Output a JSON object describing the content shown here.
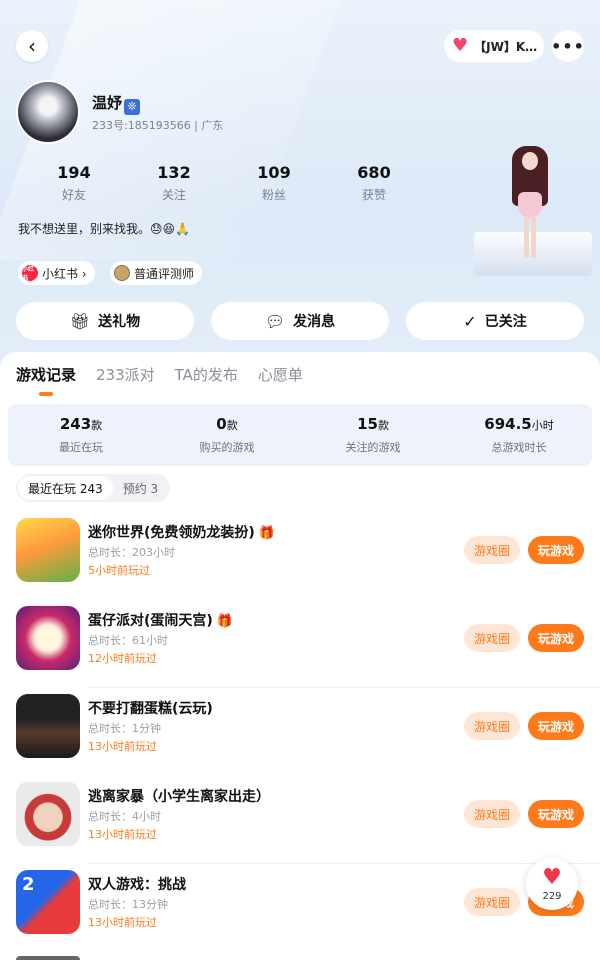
{
  "header": {
    "back_glyph": "‹",
    "pill_label": "【JW】K…",
    "more_glyph": "•••"
  },
  "profile": {
    "nickname": "温妤",
    "nick_badge": "❊",
    "uid_line": "233号:185193566 | 广东",
    "stats": [
      {
        "value": "194",
        "label": "好友"
      },
      {
        "value": "132",
        "label": "关注"
      },
      {
        "value": "109",
        "label": "粉丝"
      },
      {
        "value": "680",
        "label": "获赞"
      }
    ],
    "bio": "我不想送里，别来找我。😓😆🙏",
    "tags": {
      "xhs_icon": "小红书",
      "xhs": "小红书 ›",
      "judge": "普通评测师"
    },
    "actions": {
      "gift": "送礼物",
      "message": "发消息",
      "follow": "已关注"
    }
  },
  "tabs": [
    "游戏记录",
    "233派对",
    "TA的发布",
    "心愿单"
  ],
  "summary": [
    {
      "value": "243",
      "unit": "款",
      "label": "最近在玩"
    },
    {
      "value": "0",
      "unit": "款",
      "label": "购买的游戏"
    },
    {
      "value": "15",
      "unit": "款",
      "label": "关注的游戏"
    },
    {
      "value": "694.5",
      "unit": "小时",
      "label": "总游戏时长"
    }
  ],
  "segments": {
    "recent": "最近在玩 243",
    "reserve": "预约 3"
  },
  "games": [
    {
      "title": "迷你世界(免费领奶龙装扮)",
      "crown": "🎁",
      "duration": "总时长：203小时",
      "last": "5小时前玩过",
      "circle": "游戏圈",
      "play": "玩游戏"
    },
    {
      "title": "蛋仔派对(蛋闹天宫)",
      "crown": "🎁",
      "duration": "总时长：61小时",
      "last": "12小时前玩过",
      "circle": "游戏圈",
      "play": "玩游戏"
    },
    {
      "title": "不要打翻蛋糕(云玩)",
      "crown": "",
      "duration": "总时长：1分钟",
      "last": "13小时前玩过",
      "circle": "游戏圈",
      "play": "玩游戏"
    },
    {
      "title": "逃离家暴（小学生离家出走）",
      "crown": "",
      "duration": "总时长：4小时",
      "last": "13小时前玩过",
      "circle": "游戏圈",
      "play": "玩游戏"
    },
    {
      "title": "双人游戏：挑战",
      "crown": "",
      "duration": "总时长：13分钟",
      "last": "13小时前玩过",
      "circle": "游戏圈",
      "play": "玩游戏"
    }
  ],
  "game_icon_labels": {
    "duo": "2"
  },
  "float_like": {
    "glyph": "♥",
    "count": "229"
  },
  "colors": {
    "accent": "#ff7a1a",
    "accent_light": "#fde6d6",
    "heart": "#f0364f"
  }
}
